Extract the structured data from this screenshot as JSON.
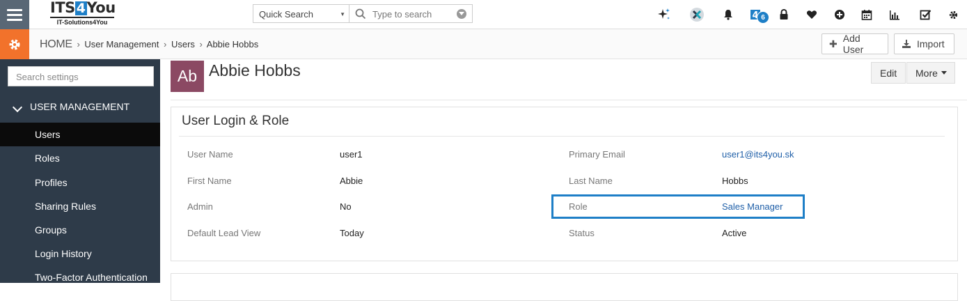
{
  "brand": {
    "logo_prefix": "ITS",
    "logo_four": "4",
    "logo_suffix": "You",
    "logo_sub": "IT-Solutions4You"
  },
  "search": {
    "scope": "Quick Search",
    "placeholder": "Type to search"
  },
  "top_icons": {
    "notification_badge": "6"
  },
  "breadcrumb": {
    "home": "HOME",
    "items": [
      "User Management",
      "Users",
      "Abbie Hobbs"
    ]
  },
  "header_buttons": {
    "add_user": "Add User",
    "import": "Import"
  },
  "sidebar": {
    "search_placeholder": "Search settings",
    "section": "USER MANAGEMENT",
    "items": [
      {
        "label": "Users",
        "active": true
      },
      {
        "label": "Roles",
        "active": false
      },
      {
        "label": "Profiles",
        "active": false
      },
      {
        "label": "Sharing Rules",
        "active": false
      },
      {
        "label": "Groups",
        "active": false
      },
      {
        "label": "Login History",
        "active": false
      },
      {
        "label": "Two-Factor Authentication",
        "active": false
      }
    ]
  },
  "record": {
    "avatar_initials": "Ab",
    "name": "Abbie Hobbs",
    "edit": "Edit",
    "more": "More"
  },
  "panel": {
    "title": "User Login & Role",
    "fields": {
      "user_name_label": "User Name",
      "user_name": "user1",
      "primary_email_label": "Primary Email",
      "primary_email": "user1@its4you.sk",
      "first_name_label": "First Name",
      "first_name": "Abbie",
      "last_name_label": "Last Name",
      "last_name": "Hobbs",
      "admin_label": "Admin",
      "admin": "No",
      "role_label": "Role",
      "role": "Sales Manager",
      "default_lead_view_label": "Default Lead View",
      "default_lead_view": "Today",
      "status_label": "Status",
      "status": "Active"
    }
  },
  "colors": {
    "accent_blue": "#1e7fc7",
    "settings_orange": "#f2722b",
    "sidebar_bg": "#2e3b49",
    "avatar_bg": "#8b4963",
    "link": "#1f5fa8"
  }
}
